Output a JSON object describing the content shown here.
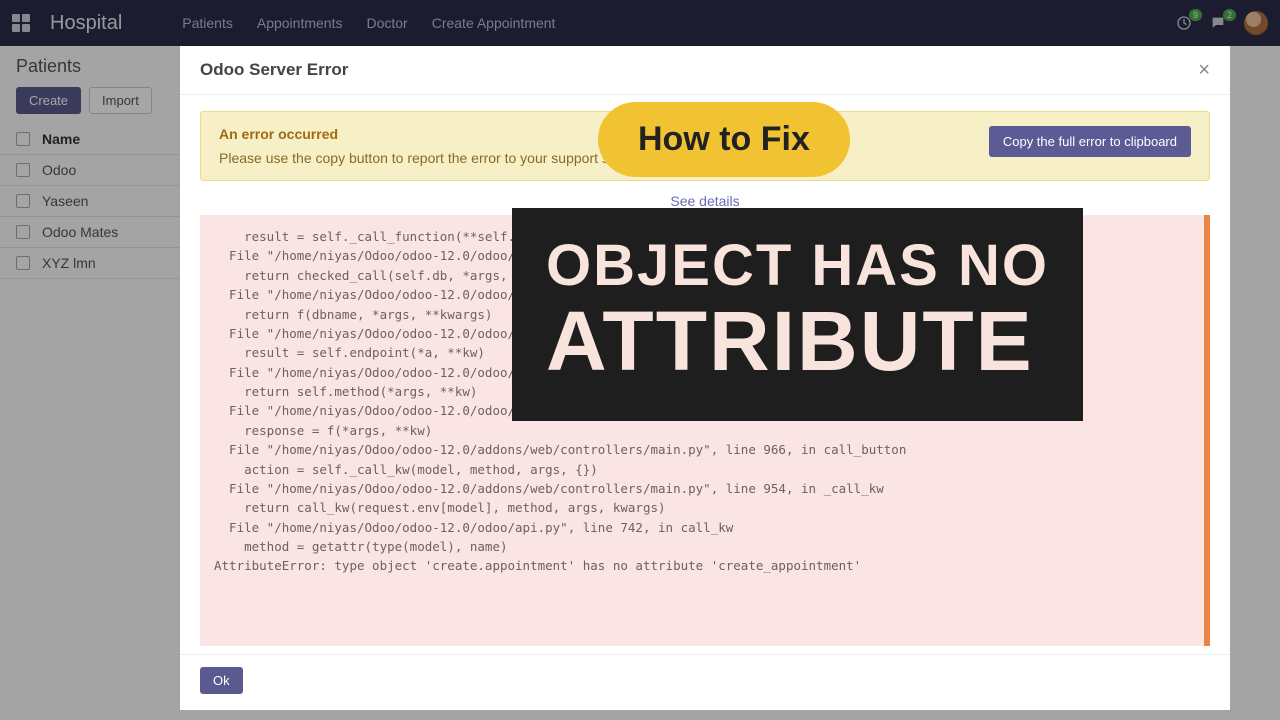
{
  "navbar": {
    "brand": "Hospital",
    "items": [
      "Patients",
      "Appointments",
      "Doctor",
      "Create Appointment"
    ],
    "activity_count": "9",
    "chat_count": "2"
  },
  "list": {
    "breadcrumb": "Patients",
    "create_label": "Create",
    "import_label": "Import",
    "column": "Name",
    "rows": [
      "Odoo",
      "Yaseen",
      "Odoo Mates",
      "XYZ lmn"
    ]
  },
  "modal": {
    "title": "Odoo Server Error",
    "alert_title": "An error occurred",
    "alert_body": "Please use the copy button to report the error to your support service.",
    "copy_button": "Copy the full error to clipboard",
    "see_details": "See details",
    "ok_label": "Ok",
    "traceback": "    result = self._call_function(**self.params)\n  File \"/home/niyas/Odoo/odoo-12.0/odoo/http.py\", line 344, in _call_function\n    return checked_call(self.db, *args, **kwargs)\n  File \"/home/niyas/Odoo/odoo-12.0/odoo/service/model.py\", line 97, in wrapper\n    return f(dbname, *args, **kwargs)\n  File \"/home/niyas/Odoo/odoo-12.0/odoo/http.py\", line 337, in checked_call\n    result = self.endpoint(*a, **kw)\n  File \"/home/niyas/Odoo/odoo-12.0/odoo/http.py\", line 939, in __call__\n    return self.method(*args, **kw)\n  File \"/home/niyas/Odoo/odoo-12.0/odoo/http.py\", line 517, in response_wrap\n    response = f(*args, **kw)\n  File \"/home/niyas/Odoo/odoo-12.0/addons/web/controllers/main.py\", line 966, in call_button\n    action = self._call_kw(model, method, args, {})\n  File \"/home/niyas/Odoo/odoo-12.0/addons/web/controllers/main.py\", line 954, in _call_kw\n    return call_kw(request.env[model], method, args, kwargs)\n  File \"/home/niyas/Odoo/odoo-12.0/odoo/api.py\", line 742, in call_kw\n    method = getattr(type(model), name)\nAttributeError: type object 'create.appointment' has no attribute 'create_appointment'"
  },
  "overlay": {
    "pill": "How to Fix",
    "line1": "OBJECT HAS NO",
    "line2": "ATTRIBUTE"
  }
}
